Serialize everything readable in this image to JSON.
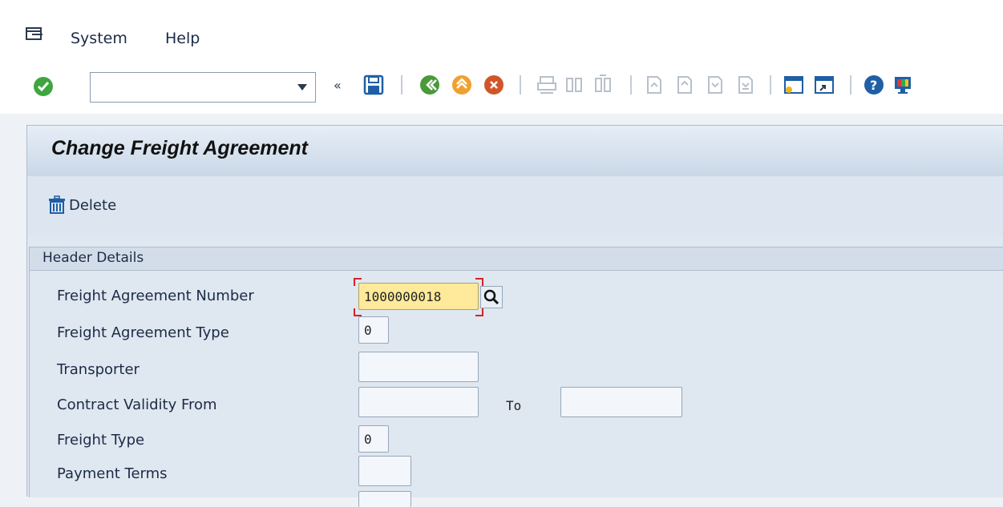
{
  "menu": {
    "items": [
      {
        "label": "System"
      },
      {
        "label": "Help"
      }
    ]
  },
  "toolbar": {
    "command_field_value": ""
  },
  "screen": {
    "title": "Change Freight Agreement"
  },
  "app_toolbar": {
    "delete_label": "Delete"
  },
  "header_details": {
    "group_title": "Header Details",
    "fields": {
      "agreement_number": {
        "label": "Freight Agreement Number",
        "value": "1000000018"
      },
      "agreement_type": {
        "label": "Freight Agreement Type",
        "value": "0"
      },
      "transporter": {
        "label": "Transporter",
        "value": ""
      },
      "validity_from": {
        "label": "Contract Validity From",
        "value": ""
      },
      "validity_to": {
        "label": "To",
        "value": ""
      },
      "freight_type": {
        "label": "Freight Type",
        "value": "0"
      },
      "payment_terms": {
        "label": "Payment Terms",
        "value": ""
      }
    }
  },
  "colors": {
    "active_field": "#ffe99a",
    "focus_marker": "#d2242a",
    "title_bar": "#c9d7e6"
  }
}
